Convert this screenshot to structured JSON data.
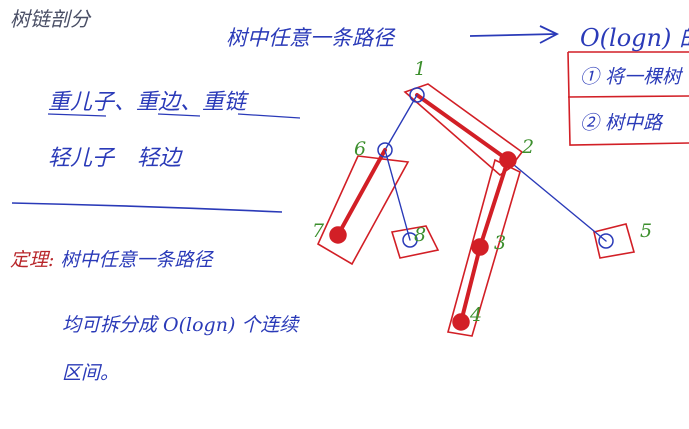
{
  "notes": {
    "title": "树链剖分",
    "top_claim": "树中任意一条路径",
    "complexity": "O(logn) 的",
    "box_line_1": "① 将一棵树",
    "box_line_2": "② 树中路",
    "terms_row_1": "重儿子、重边、重链",
    "terms_row_2": "轻儿子  轻边",
    "theorem_label": "定理:",
    "theorem_body": "树中任意一条路径",
    "theorem_text_1": "均可拆分成 O(logn) 个连续",
    "theorem_text_2": "区间。"
  },
  "tree": {
    "nodes": [
      {
        "id": "1",
        "label": "1",
        "heavy": false
      },
      {
        "id": "2",
        "label": "2",
        "heavy": true
      },
      {
        "id": "3",
        "label": "3",
        "heavy": true
      },
      {
        "id": "4",
        "label": "4",
        "heavy": true
      },
      {
        "id": "5",
        "label": "5",
        "heavy": false
      },
      {
        "id": "6",
        "label": "6",
        "heavy": false
      },
      {
        "id": "7",
        "label": "7",
        "heavy": true
      },
      {
        "id": "8",
        "label": "8",
        "heavy": false
      }
    ],
    "edges": [
      {
        "from": "1",
        "to": "2",
        "heavy": true
      },
      {
        "from": "2",
        "to": "3",
        "heavy": true
      },
      {
        "from": "3",
        "to": "4",
        "heavy": true
      },
      {
        "from": "2",
        "to": "5",
        "heavy": false
      },
      {
        "from": "1",
        "to": "6",
        "heavy": false
      },
      {
        "from": "6",
        "to": "7",
        "heavy": true
      },
      {
        "from": "6",
        "to": "8",
        "heavy": false
      }
    ]
  },
  "colors": {
    "ink_blue": "#2a3ab8",
    "ink_red": "#d21f26",
    "ink_green": "#3c8f2d",
    "ink_grey": "#4a4f66"
  }
}
